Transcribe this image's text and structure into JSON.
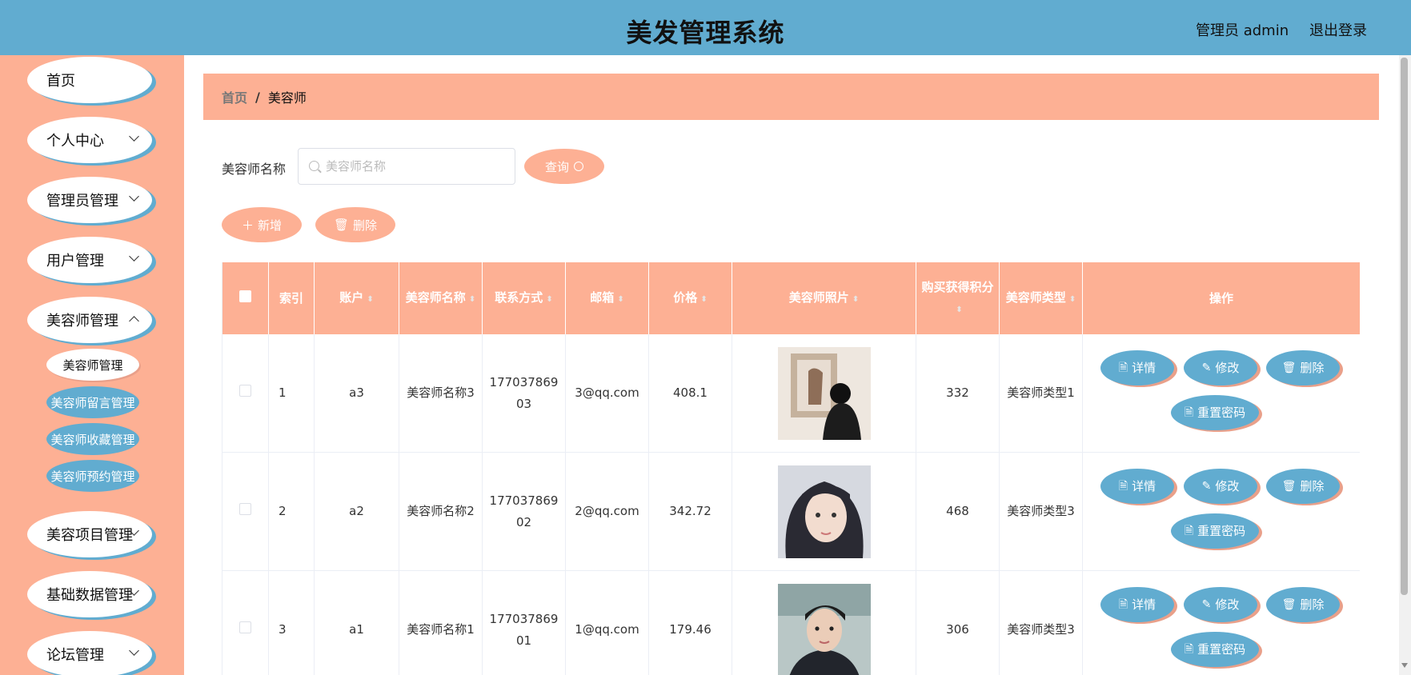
{
  "header": {
    "title": "美发管理系统",
    "user_label": "管理员 admin",
    "logout_label": "退出登录"
  },
  "sidebar": {
    "items": [
      {
        "label": "首页",
        "has_arrow": false
      },
      {
        "label": "个人中心",
        "has_arrow": true
      },
      {
        "label": "管理员管理",
        "has_arrow": true
      },
      {
        "label": "用户管理",
        "has_arrow": true
      },
      {
        "label": "美容师管理",
        "has_arrow": true
      },
      {
        "label": "美容项目管理",
        "has_arrow": true
      },
      {
        "label": "基础数据管理",
        "has_arrow": true
      },
      {
        "label": "论坛管理",
        "has_arrow": true
      }
    ],
    "submenu": [
      "美容师管理",
      "美容师留言管理",
      "美容师收藏管理",
      "美容师预约管理"
    ]
  },
  "breadcrumb": {
    "home": "首页",
    "separator": "/",
    "current": "美容师"
  },
  "search": {
    "label": "美容师名称",
    "placeholder": "美容师名称",
    "value": "",
    "query_label": "查询"
  },
  "actions": {
    "add_label": "新增",
    "delete_label": "删除"
  },
  "table": {
    "headers": [
      "索引",
      "账户",
      "美容师名称",
      "联系方式",
      "邮箱",
      "价格",
      "美容师照片",
      "购买获得积分",
      "美容师类型",
      "操作"
    ],
    "op_labels": {
      "detail": "详情",
      "edit": "修改",
      "delete": "删除",
      "reset": "重置密码"
    },
    "rows": [
      {
        "index": "1",
        "account": "a3",
        "name": "美容师名称3",
        "phone": "17703786903",
        "email": "3@qq.com",
        "price": "408.1",
        "photo": "photo-man-back",
        "points": "332",
        "type": "美容师类型1"
      },
      {
        "index": "2",
        "account": "a2",
        "name": "美容师名称2",
        "phone": "17703786902",
        "email": "2@qq.com",
        "price": "342.72",
        "photo": "photo-woman",
        "points": "468",
        "type": "美容师类型3"
      },
      {
        "index": "3",
        "account": "a1",
        "name": "美容师名称1",
        "phone": "17703786901",
        "email": "1@qq.com",
        "price": "179.46",
        "photo": "photo-man",
        "points": "306",
        "type": "美容师类型3"
      }
    ]
  },
  "colors": {
    "header": "#61acd0",
    "accent": "#fdb094",
    "button_blue": "#61acd0"
  }
}
